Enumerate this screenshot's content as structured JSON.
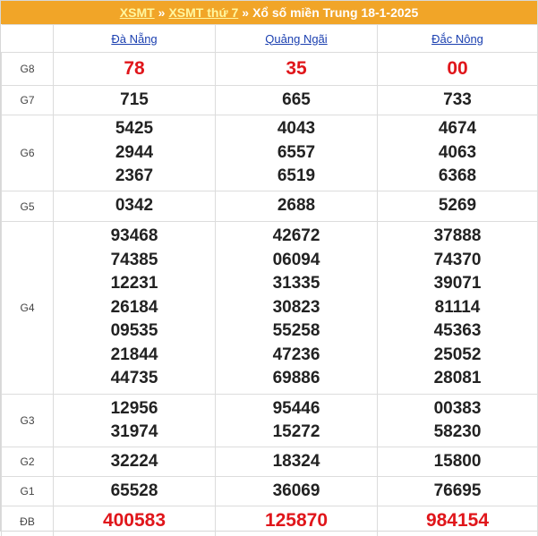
{
  "breadcrumb": {
    "link1": "XSMT",
    "sep1": "»",
    "link2": "XSMT thứ 7",
    "sep2": "»",
    "title": "Xổ số miền Trung 18-1-2025"
  },
  "provinces": [
    "Đà Nẵng",
    "Quảng Ngãi",
    "Đắc Nông"
  ],
  "prizes": [
    {
      "label": "G8",
      "values": [
        [
          "78"
        ],
        [
          "35"
        ],
        [
          "00"
        ]
      ]
    },
    {
      "label": "G7",
      "values": [
        [
          "715"
        ],
        [
          "665"
        ],
        [
          "733"
        ]
      ]
    },
    {
      "label": "G6",
      "values": [
        [
          "5425",
          "2944",
          "2367"
        ],
        [
          "4043",
          "6557",
          "6519"
        ],
        [
          "4674",
          "4063",
          "6368"
        ]
      ]
    },
    {
      "label": "G5",
      "values": [
        [
          "0342"
        ],
        [
          "2688"
        ],
        [
          "5269"
        ]
      ]
    },
    {
      "label": "G4",
      "values": [
        [
          "93468",
          "74385",
          "12231",
          "26184",
          "09535",
          "21844",
          "44735"
        ],
        [
          "42672",
          "06094",
          "31335",
          "30823",
          "55258",
          "47236",
          "69886"
        ],
        [
          "37888",
          "74370",
          "39071",
          "81114",
          "45363",
          "25052",
          "28081"
        ]
      ]
    },
    {
      "label": "G3",
      "values": [
        [
          "12956",
          "31974"
        ],
        [
          "95446",
          "15272"
        ],
        [
          "00383",
          "58230"
        ]
      ]
    },
    {
      "label": "G2",
      "values": [
        [
          "32224"
        ],
        [
          "18324"
        ],
        [
          "15800"
        ]
      ]
    },
    {
      "label": "G1",
      "values": [
        [
          "65528"
        ],
        [
          "36069"
        ],
        [
          "76695"
        ]
      ]
    },
    {
      "label": "ĐB",
      "values": [
        [
          "400583"
        ],
        [
          "125870"
        ],
        [
          "984154"
        ]
      ]
    }
  ],
  "colors": {
    "header_bg": "#f1a528",
    "link_yellow": "#fff7a0",
    "province_link": "#1a3fb0",
    "highlight_red": "#e0161b"
  }
}
